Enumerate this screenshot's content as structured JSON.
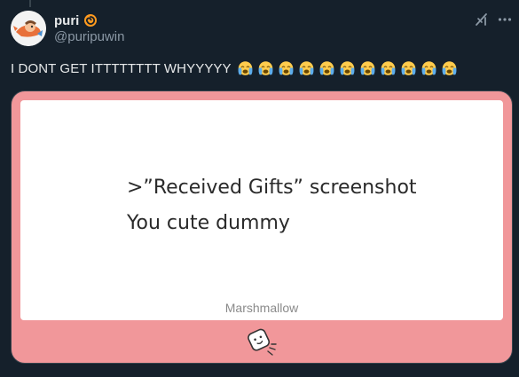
{
  "author": {
    "display_name": "puri",
    "handle": "@puripuwin",
    "badge_icon": "orange-spiral-badge-icon",
    "avatar_icon": "avatar-cartoon-icon"
  },
  "header_actions": {
    "grok_icon": "grok-icon",
    "more_icon": "more-options-icon"
  },
  "tweet": {
    "text": "I DONT GET ITTTTTTTT WHYYYYY",
    "emoji_icon": "loudly-crying-face-icon",
    "emoji_count": 11
  },
  "media": {
    "line1": ">”Received Gifts” screenshot",
    "line2": "You cute dummy",
    "brand": "Marshmallow",
    "mascot_icon": "marshmallow-mascot-icon",
    "card_color": "#f1979a"
  },
  "colors": {
    "background": "#15202b",
    "text": "#e7e9ea",
    "muted": "#8b98a5",
    "border": "#38444d"
  }
}
